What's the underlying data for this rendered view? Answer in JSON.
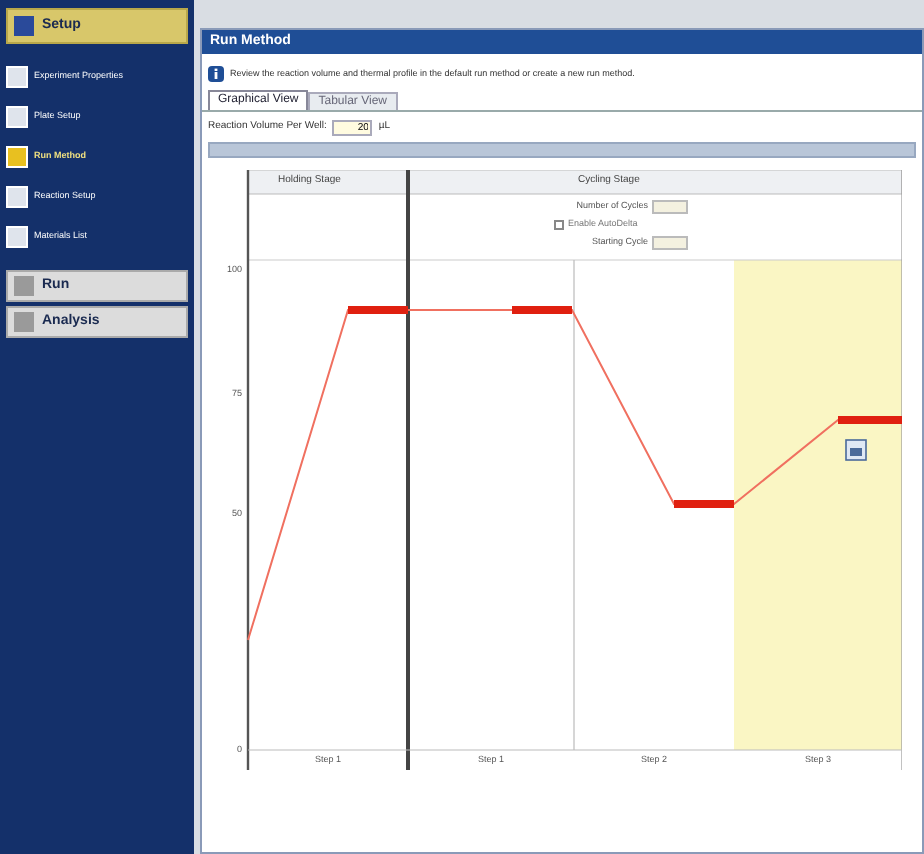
{
  "sidebar": {
    "sections": [
      {
        "label": "Setup",
        "expanded": true,
        "items": [
          {
            "label": "Experiment Properties",
            "selected": false
          },
          {
            "label": "Plate Setup",
            "selected": false
          },
          {
            "label": "Run Method",
            "selected": true
          },
          {
            "label": "Reaction Setup",
            "selected": false
          },
          {
            "label": "Materials List",
            "selected": false
          }
        ]
      },
      {
        "label": "Run",
        "expanded": false
      },
      {
        "label": "Analysis",
        "expanded": false
      }
    ]
  },
  "panel": {
    "title": "Run Method",
    "instructions": "Review the reaction volume and thermal profile in the default run method or create a new run method.",
    "tabs": [
      {
        "label": "Graphical View",
        "selected": true
      },
      {
        "label": "Tabular View",
        "selected": false
      }
    ],
    "volume": {
      "label": "Reaction Volume Per Well:",
      "value": "20",
      "unit": "µL"
    },
    "stages": [
      {
        "title": "Holding Stage"
      },
      {
        "title": "Cycling Stage"
      }
    ],
    "cycling_settings": [
      {
        "kind": "field",
        "label": "Number of Cycles"
      },
      {
        "kind": "checkbox",
        "label": "Enable AutoDelta",
        "checked": false
      },
      {
        "kind": "field",
        "label": "Starting Cycle"
      }
    ],
    "y_ticks": [
      "100",
      "75",
      "50",
      "0"
    ],
    "steps": [
      "Step 1",
      "Step 1",
      "Step 2",
      "Step 3"
    ]
  }
}
